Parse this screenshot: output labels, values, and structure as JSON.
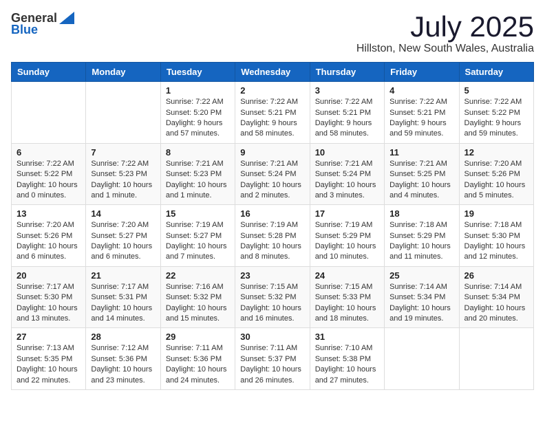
{
  "header": {
    "logo_line1": "General",
    "logo_line2": "Blue",
    "month": "July 2025",
    "location": "Hillston, New South Wales, Australia"
  },
  "weekdays": [
    "Sunday",
    "Monday",
    "Tuesday",
    "Wednesday",
    "Thursday",
    "Friday",
    "Saturday"
  ],
  "weeks": [
    [
      {
        "day": "",
        "info": ""
      },
      {
        "day": "",
        "info": ""
      },
      {
        "day": "1",
        "info": "Sunrise: 7:22 AM\nSunset: 5:20 PM\nDaylight: 9 hours\nand 57 minutes."
      },
      {
        "day": "2",
        "info": "Sunrise: 7:22 AM\nSunset: 5:21 PM\nDaylight: 9 hours\nand 58 minutes."
      },
      {
        "day": "3",
        "info": "Sunrise: 7:22 AM\nSunset: 5:21 PM\nDaylight: 9 hours\nand 58 minutes."
      },
      {
        "day": "4",
        "info": "Sunrise: 7:22 AM\nSunset: 5:21 PM\nDaylight: 9 hours\nand 59 minutes."
      },
      {
        "day": "5",
        "info": "Sunrise: 7:22 AM\nSunset: 5:22 PM\nDaylight: 9 hours\nand 59 minutes."
      }
    ],
    [
      {
        "day": "6",
        "info": "Sunrise: 7:22 AM\nSunset: 5:22 PM\nDaylight: 10 hours\nand 0 minutes."
      },
      {
        "day": "7",
        "info": "Sunrise: 7:22 AM\nSunset: 5:23 PM\nDaylight: 10 hours\nand 1 minute."
      },
      {
        "day": "8",
        "info": "Sunrise: 7:21 AM\nSunset: 5:23 PM\nDaylight: 10 hours\nand 1 minute."
      },
      {
        "day": "9",
        "info": "Sunrise: 7:21 AM\nSunset: 5:24 PM\nDaylight: 10 hours\nand 2 minutes."
      },
      {
        "day": "10",
        "info": "Sunrise: 7:21 AM\nSunset: 5:24 PM\nDaylight: 10 hours\nand 3 minutes."
      },
      {
        "day": "11",
        "info": "Sunrise: 7:21 AM\nSunset: 5:25 PM\nDaylight: 10 hours\nand 4 minutes."
      },
      {
        "day": "12",
        "info": "Sunrise: 7:20 AM\nSunset: 5:26 PM\nDaylight: 10 hours\nand 5 minutes."
      }
    ],
    [
      {
        "day": "13",
        "info": "Sunrise: 7:20 AM\nSunset: 5:26 PM\nDaylight: 10 hours\nand 6 minutes."
      },
      {
        "day": "14",
        "info": "Sunrise: 7:20 AM\nSunset: 5:27 PM\nDaylight: 10 hours\nand 6 minutes."
      },
      {
        "day": "15",
        "info": "Sunrise: 7:19 AM\nSunset: 5:27 PM\nDaylight: 10 hours\nand 7 minutes."
      },
      {
        "day": "16",
        "info": "Sunrise: 7:19 AM\nSunset: 5:28 PM\nDaylight: 10 hours\nand 8 minutes."
      },
      {
        "day": "17",
        "info": "Sunrise: 7:19 AM\nSunset: 5:29 PM\nDaylight: 10 hours\nand 10 minutes."
      },
      {
        "day": "18",
        "info": "Sunrise: 7:18 AM\nSunset: 5:29 PM\nDaylight: 10 hours\nand 11 minutes."
      },
      {
        "day": "19",
        "info": "Sunrise: 7:18 AM\nSunset: 5:30 PM\nDaylight: 10 hours\nand 12 minutes."
      }
    ],
    [
      {
        "day": "20",
        "info": "Sunrise: 7:17 AM\nSunset: 5:30 PM\nDaylight: 10 hours\nand 13 minutes."
      },
      {
        "day": "21",
        "info": "Sunrise: 7:17 AM\nSunset: 5:31 PM\nDaylight: 10 hours\nand 14 minutes."
      },
      {
        "day": "22",
        "info": "Sunrise: 7:16 AM\nSunset: 5:32 PM\nDaylight: 10 hours\nand 15 minutes."
      },
      {
        "day": "23",
        "info": "Sunrise: 7:15 AM\nSunset: 5:32 PM\nDaylight: 10 hours\nand 16 minutes."
      },
      {
        "day": "24",
        "info": "Sunrise: 7:15 AM\nSunset: 5:33 PM\nDaylight: 10 hours\nand 18 minutes."
      },
      {
        "day": "25",
        "info": "Sunrise: 7:14 AM\nSunset: 5:34 PM\nDaylight: 10 hours\nand 19 minutes."
      },
      {
        "day": "26",
        "info": "Sunrise: 7:14 AM\nSunset: 5:34 PM\nDaylight: 10 hours\nand 20 minutes."
      }
    ],
    [
      {
        "day": "27",
        "info": "Sunrise: 7:13 AM\nSunset: 5:35 PM\nDaylight: 10 hours\nand 22 minutes."
      },
      {
        "day": "28",
        "info": "Sunrise: 7:12 AM\nSunset: 5:36 PM\nDaylight: 10 hours\nand 23 minutes."
      },
      {
        "day": "29",
        "info": "Sunrise: 7:11 AM\nSunset: 5:36 PM\nDaylight: 10 hours\nand 24 minutes."
      },
      {
        "day": "30",
        "info": "Sunrise: 7:11 AM\nSunset: 5:37 PM\nDaylight: 10 hours\nand 26 minutes."
      },
      {
        "day": "31",
        "info": "Sunrise: 7:10 AM\nSunset: 5:38 PM\nDaylight: 10 hours\nand 27 minutes."
      },
      {
        "day": "",
        "info": ""
      },
      {
        "day": "",
        "info": ""
      }
    ]
  ]
}
